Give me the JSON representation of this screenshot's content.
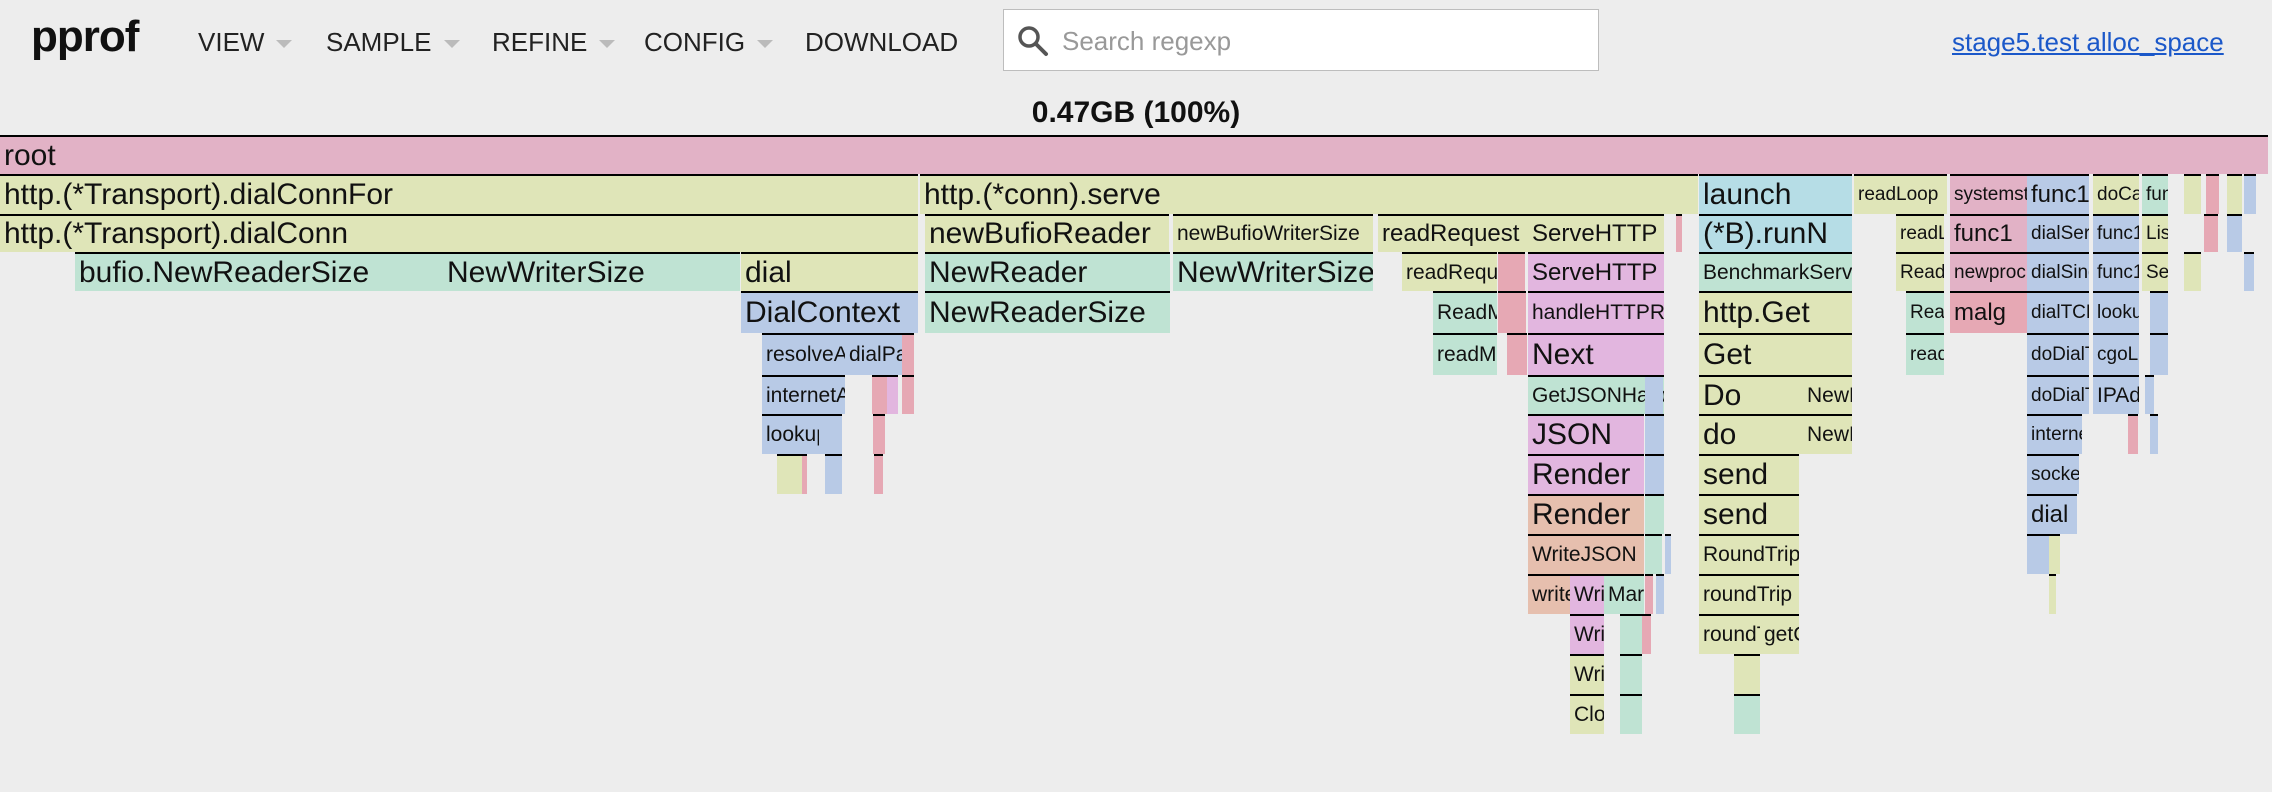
{
  "app": {
    "logo": "pprof",
    "menus": [
      "VIEW",
      "SAMPLE",
      "REFINE",
      "CONFIG",
      "DOWNLOAD"
    ],
    "search_placeholder": "Search regexp",
    "profile_link": "stage5.test alloc_space"
  },
  "flamegraph": {
    "title": "0.47GB (100%)",
    "colors": {
      "pink": "#e2b2c6",
      "olive": "#dfe5b8",
      "teal": "#bfe3d3",
      "blue": "#b8cae6",
      "cyan": "#b6dde6",
      "magenta": "#e2b6df",
      "salmon": "#e6bfae",
      "rose": "#e6a8b4"
    },
    "frames": [
      {
        "label": "root",
        "color": "pink"
      },
      {
        "label": "http.(*Transport).dialConnFor",
        "color": "olive"
      },
      {
        "label": "http.(*conn).serve",
        "color": "olive"
      },
      {
        "label": "launch",
        "color": "cyan"
      },
      {
        "label": "readLoop",
        "color": "olive"
      },
      {
        "label": "systemstack",
        "color": "pink"
      },
      {
        "label": "func1",
        "color": "blue"
      },
      {
        "label": "doCall",
        "color": "olive"
      },
      {
        "label": "func",
        "color": "teal"
      },
      {
        "label": "",
        "color": "olive"
      },
      {
        "label": "",
        "color": "rose"
      },
      {
        "label": "",
        "color": "olive"
      },
      {
        "label": "",
        "color": "blue"
      },
      {
        "label": "http.(*Transport).dialConn",
        "color": "olive"
      },
      {
        "label": "newBufioReader",
        "color": "olive"
      },
      {
        "label": "newBufioWriterSize",
        "color": "olive"
      },
      {
        "label": "readRequest",
        "color": "olive"
      },
      {
        "label": "ServeHTTP",
        "color": "olive"
      },
      {
        "label": "",
        "color": "rose"
      },
      {
        "label": "(*B).runN",
        "color": "cyan"
      },
      {
        "label": "readLoop",
        "color": "olive"
      },
      {
        "label": "func1",
        "color": "pink"
      },
      {
        "label": "dialSerial",
        "color": "blue"
      },
      {
        "label": "func1",
        "color": "blue"
      },
      {
        "label": "List",
        "color": "olive"
      },
      {
        "label": "",
        "color": "rose"
      },
      {
        "label": "",
        "color": "blue"
      },
      {
        "label": "bufio.NewReaderSize",
        "color": "teal"
      },
      {
        "label": "NewWriterSize",
        "color": "teal"
      },
      {
        "label": "dial",
        "color": "olive"
      },
      {
        "label": "NewReader",
        "color": "teal"
      },
      {
        "label": "NewWriterSize",
        "color": "teal"
      },
      {
        "label": "readRequest",
        "color": "olive"
      },
      {
        "label": "",
        "color": "rose"
      },
      {
        "label": "ServeHTTP",
        "color": "magenta"
      },
      {
        "label": "BenchmarkServe",
        "color": "teal"
      },
      {
        "label": "Read",
        "color": "olive"
      },
      {
        "label": "newproc",
        "color": "pink"
      },
      {
        "label": "dialSingle",
        "color": "blue"
      },
      {
        "label": "func1",
        "color": "blue"
      },
      {
        "label": "Serve",
        "color": "olive"
      },
      {
        "label": "",
        "color": "olive"
      },
      {
        "label": "",
        "color": "blue"
      },
      {
        "label": "DialContext",
        "color": "blue"
      },
      {
        "label": "NewReaderSize",
        "color": "teal"
      },
      {
        "label": "ReadMIMEHeader",
        "color": "teal"
      },
      {
        "label": "",
        "color": "rose"
      },
      {
        "label": "handleHTTPRequest",
        "color": "magenta"
      },
      {
        "label": "http.Get",
        "color": "olive"
      },
      {
        "label": "Read",
        "color": "teal"
      },
      {
        "label": "malg",
        "color": "rose"
      },
      {
        "label": "dialTCP",
        "color": "blue"
      },
      {
        "label": "lookup",
        "color": "blue"
      },
      {
        "label": "",
        "color": "blue"
      },
      {
        "label": "resolveAddrList",
        "color": "blue"
      },
      {
        "label": "dialParallel",
        "color": "blue"
      },
      {
        "label": "",
        "color": "rose"
      },
      {
        "label": "readMIMEHeader",
        "color": "teal"
      },
      {
        "label": "",
        "color": "rose"
      },
      {
        "label": "Next",
        "color": "magenta"
      },
      {
        "label": "Get",
        "color": "olive"
      },
      {
        "label": "read",
        "color": "teal"
      },
      {
        "label": "doDialTCP",
        "color": "blue"
      },
      {
        "label": "cgoLookup",
        "color": "blue"
      },
      {
        "label": "",
        "color": "blue"
      },
      {
        "label": "internetAddrList",
        "color": "blue"
      },
      {
        "label": "",
        "color": "rose"
      },
      {
        "label": "",
        "color": "magenta"
      },
      {
        "label": "",
        "color": "rose"
      },
      {
        "label": "GetJSONHandler",
        "color": "teal"
      },
      {
        "label": "",
        "color": "blue"
      },
      {
        "label": "Do",
        "color": "olive"
      },
      {
        "label": "NewRequest",
        "color": "olive"
      },
      {
        "label": "doDialTCP",
        "color": "blue"
      },
      {
        "label": "IPAddr",
        "color": "blue"
      },
      {
        "label": "",
        "color": "blue"
      },
      {
        "label": "lookup",
        "color": "blue"
      },
      {
        "label": "",
        "color": "blue"
      },
      {
        "label": "",
        "color": "rose"
      },
      {
        "label": "JSON",
        "color": "magenta"
      },
      {
        "label": "",
        "color": "blue"
      },
      {
        "label": "do",
        "color": "olive"
      },
      {
        "label": "NewRequest",
        "color": "olive"
      },
      {
        "label": "internetSocket",
        "color": "blue"
      },
      {
        "label": "",
        "color": "rose"
      },
      {
        "label": "",
        "color": "blue"
      },
      {
        "label": "",
        "color": "olive"
      },
      {
        "label": "",
        "color": "rose"
      },
      {
        "label": "",
        "color": "blue"
      },
      {
        "label": "",
        "color": "rose"
      },
      {
        "label": "Render",
        "color": "magenta"
      },
      {
        "label": "",
        "color": "blue"
      },
      {
        "label": "send",
        "color": "olive"
      },
      {
        "label": "socket",
        "color": "blue"
      },
      {
        "label": "Render",
        "color": "salmon"
      },
      {
        "label": "",
        "color": "teal"
      },
      {
        "label": "send",
        "color": "olive"
      },
      {
        "label": "dial",
        "color": "blue"
      },
      {
        "label": "WriteJSON",
        "color": "salmon"
      },
      {
        "label": "",
        "color": "teal"
      },
      {
        "label": "",
        "color": "blue"
      },
      {
        "label": "RoundTrip",
        "color": "olive"
      },
      {
        "label": "",
        "color": "blue"
      },
      {
        "label": "",
        "color": "olive"
      },
      {
        "label": "write",
        "color": "salmon"
      },
      {
        "label": "Write",
        "color": "magenta"
      },
      {
        "label": "Marshal",
        "color": "teal"
      },
      {
        "label": "",
        "color": "rose"
      },
      {
        "label": "",
        "color": "blue"
      },
      {
        "label": "roundTrip",
        "color": "olive"
      },
      {
        "label": "",
        "color": "olive"
      },
      {
        "label": "Write",
        "color": "magenta"
      },
      {
        "label": "",
        "color": "teal"
      },
      {
        "label": "",
        "color": "rose"
      },
      {
        "label": "roundTrip",
        "color": "olive"
      },
      {
        "label": "getConn",
        "color": "olive"
      },
      {
        "label": "Write",
        "color": "olive"
      },
      {
        "label": "",
        "color": "teal"
      },
      {
        "label": "",
        "color": "olive"
      },
      {
        "label": "Close",
        "color": "olive"
      },
      {
        "label": "",
        "color": "teal"
      },
      {
        "label": "",
        "color": "teal"
      }
    ]
  }
}
